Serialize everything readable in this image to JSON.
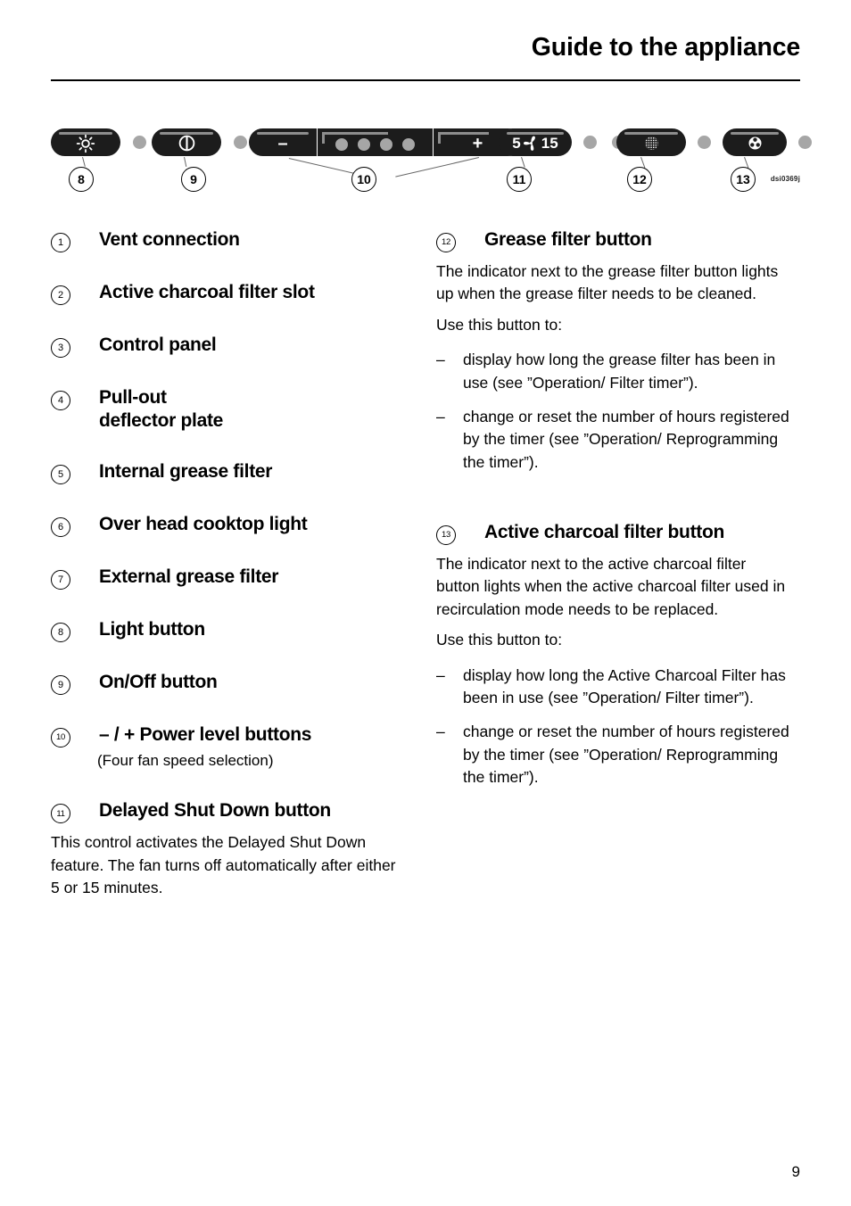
{
  "header": {
    "title": "Guide to the appliance"
  },
  "diagram": {
    "figure_code": "dsi0369j",
    "controls": [
      {
        "id": "light",
        "glyph": "light-icon",
        "callout": "8"
      },
      {
        "id": "onoff",
        "glyph": "power-icon",
        "callout": "9"
      },
      {
        "id": "minus",
        "glyph": "minus-icon",
        "label": "–",
        "callout": "10"
      },
      {
        "id": "level-dots",
        "glyph": "level-indicator-dots",
        "dots": 4
      },
      {
        "id": "plus",
        "glyph": "plus-icon",
        "label": "+",
        "callout": "10"
      },
      {
        "id": "delayed-shutdown",
        "glyph": "fan-icon",
        "left_label": "5",
        "right_label": "15",
        "callout": "11"
      },
      {
        "id": "grease-filter",
        "glyph": "mesh-filter-icon",
        "callout": "12"
      },
      {
        "id": "charcoal-filter",
        "glyph": "charcoal-filter-icon",
        "callout": "13"
      }
    ],
    "callouts": [
      "8",
      "9",
      "10",
      "11",
      "12",
      "13"
    ]
  },
  "left_column": {
    "items": [
      {
        "num": "1",
        "title": "Vent connection"
      },
      {
        "num": "2",
        "title": "Active charcoal filter slot"
      },
      {
        "num": "3",
        "title": "Control panel"
      },
      {
        "num": "4",
        "title_line1": "Pull-out",
        "title_line2": "deflector plate"
      },
      {
        "num": "5",
        "title": "Internal grease filter"
      },
      {
        "num": "6",
        "title": "Over head cooktop light"
      },
      {
        "num": "7",
        "title": "External grease filter"
      },
      {
        "num": "8",
        "title": "Light button"
      },
      {
        "num": "9",
        "title": "On/Off button"
      },
      {
        "num": "10",
        "title": "– / + Power level buttons",
        "subnote": "(Four fan speed selection)"
      },
      {
        "num": "11",
        "title": "Delayed Shut Down button",
        "paragraph": "This control activates the Delayed Shut Down feature. The fan turns off automatically after either 5 or 15 minutes."
      }
    ]
  },
  "right_column": {
    "item_12": {
      "num": "12",
      "title": "Grease filter button",
      "paragraph1": "The indicator next to the grease filter button lights up when the grease filter needs to be cleaned.",
      "paragraph2": "Use this button to:",
      "dash": "–",
      "bullets": [
        "display how long the grease filter has been in use (see ”Operation/ Filter timer”).",
        "change or reset the number of hours registered by the timer (see ”Operation/ Reprogramming the timer”)."
      ]
    },
    "item_13": {
      "num": "13",
      "title": "Active charcoal filter button",
      "paragraph1": "The indicator next to the active charcoal filter button lights when the active charcoal filter used in recirculation mode needs to be replaced.",
      "paragraph2": "Use this button to:",
      "dash": "–",
      "bullets": [
        "display how long the Active Charcoal Filter has been in use (see ”Operation/ Filter timer”).",
        "change or reset the number of hours registered by the timer (see ”Operation/ Reprogramming the timer”)."
      ]
    }
  },
  "footer": {
    "page_number": "9"
  }
}
